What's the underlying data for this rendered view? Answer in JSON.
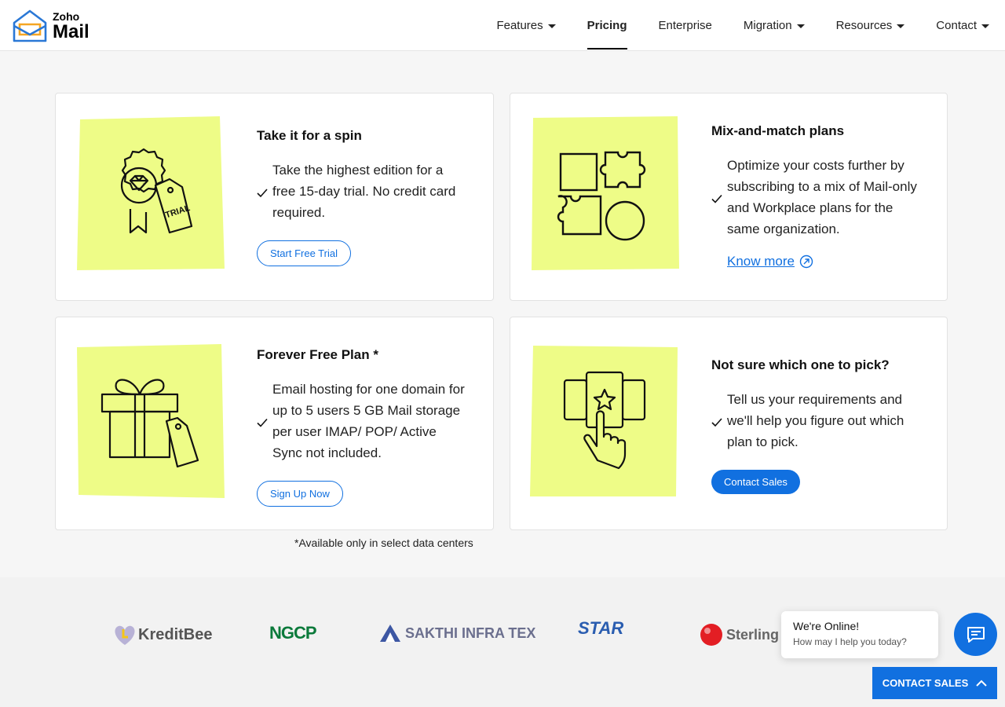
{
  "header": {
    "logo_zoho": "Zoho",
    "logo_mail": "Mail",
    "nav": [
      {
        "label": "Features",
        "dropdown": true
      },
      {
        "label": "Pricing",
        "dropdown": false,
        "active": true
      },
      {
        "label": "Enterprise",
        "dropdown": false
      },
      {
        "label": "Migration",
        "dropdown": true
      },
      {
        "label": "Resources",
        "dropdown": true
      },
      {
        "label": "Contact",
        "dropdown": true
      }
    ]
  },
  "cards": {
    "trial": {
      "title": "Take it for a spin",
      "text": "Take the highest edition for a free 15-day trial. No credit card required.",
      "button": "Start Free Trial",
      "tag_text": "TRIAL"
    },
    "mix": {
      "title": "Mix-and-match plans",
      "text": "Optimize your costs further by subscribing to a mix of Mail-only and Workplace plans for the same organization.",
      "link": "Know more"
    },
    "free": {
      "title": "Forever Free Plan *",
      "text": "Email hosting for one domain for up to 5 users 5 GB Mail storage per user IMAP/ POP/ Active Sync not included.",
      "button": "Sign Up Now"
    },
    "pick": {
      "title": "Not sure which one to pick?",
      "text": "Tell us your requirements and we'll help you figure out which plan to pick.",
      "button": "Contact Sales"
    }
  },
  "note": "*Available only in select data centers",
  "logos": [
    "KreditBee",
    "NGCP",
    "SAKTHI INFRA TEX",
    "STAR",
    "Sterling"
  ],
  "chat": {
    "title": "We're Online!",
    "subtitle": "How may I help you today?"
  },
  "contact_sales_bar": "CONTACT SALES",
  "colors": {
    "accent": "#1170e0",
    "illustration_bg": "#eefc87"
  }
}
